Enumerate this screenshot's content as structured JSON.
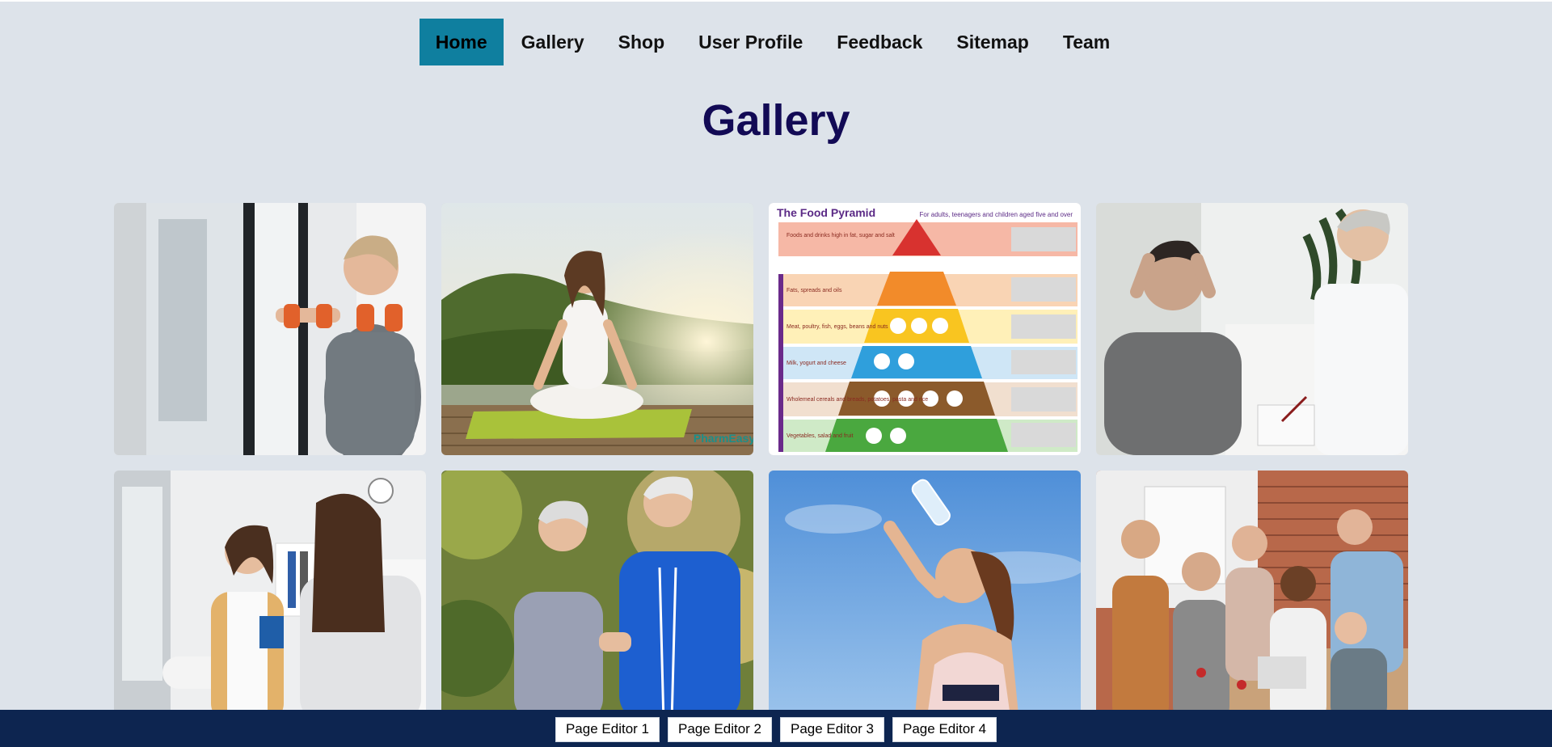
{
  "nav": {
    "items": [
      {
        "label": "Home",
        "active": true
      },
      {
        "label": "Gallery",
        "active": false
      },
      {
        "label": "Shop",
        "active": false
      },
      {
        "label": "User Profile",
        "active": false
      },
      {
        "label": "Feedback",
        "active": false
      },
      {
        "label": "Sitemap",
        "active": false
      },
      {
        "label": "Team",
        "active": false
      }
    ]
  },
  "page": {
    "title": "Gallery"
  },
  "gallery": {
    "food_pyramid": {
      "title": "The Food Pyramid",
      "subtitle": "For adults, teenagers and children aged five and over",
      "tiers": [
        "Foods and drinks high in fat, sugar and salt",
        "Fats, spreads and oils",
        "Meat, poultry, fish, eggs, beans and nuts",
        "Milk, yogurt and cheese",
        "Wholemeal cereals and breads, potatoes, pasta and rice",
        "Vegetables, salad and fruit"
      ]
    },
    "yoga_watermark": "PharmEasy"
  },
  "footer": {
    "buttons": [
      "Page Editor 1",
      "Page Editor 2",
      "Page Editor 3",
      "Page Editor 4"
    ]
  },
  "colors": {
    "page_bg": "#dde3ea",
    "nav_active_bg": "#0f7f9f",
    "title": "#120a55",
    "footer_bg": "#0d2550"
  }
}
